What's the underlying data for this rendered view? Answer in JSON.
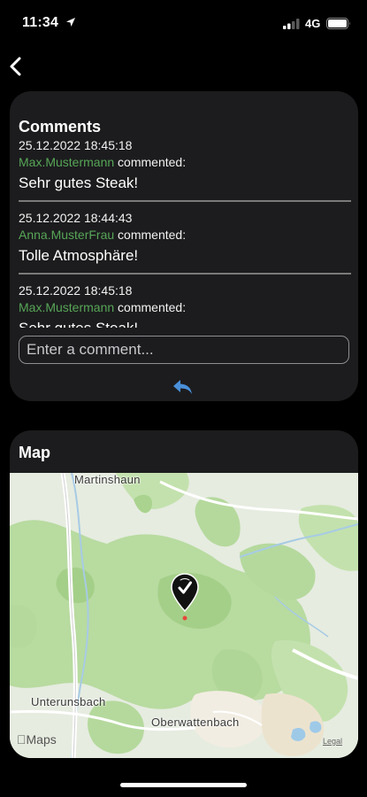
{
  "status_bar": {
    "time": "11:34",
    "network": "4G",
    "icons": [
      "location-arrow-icon",
      "signal-icon",
      "battery-icon"
    ]
  },
  "nav": {
    "back_icon": "chevron-left-icon"
  },
  "comments": {
    "title": "Comments",
    "items": [
      {
        "timestamp": "25.12.2022 18:45:18",
        "author": "Max.Mustermann",
        "action": " commented:",
        "text": "Sehr gutes Steak!"
      },
      {
        "timestamp": "25.12.2022 18:44:43",
        "author": "Anna.MusterFrau",
        "action": " commented:",
        "text": "Tolle Atmosphäre!"
      },
      {
        "timestamp": "25.12.2022 18:45:18",
        "author": "Max.Mustermann",
        "action": " commented:",
        "text": "Sehr gutes Steak!"
      }
    ],
    "input_placeholder": "Enter a comment...",
    "send_icon": "reply-arrow-icon"
  },
  "map": {
    "title": "Map",
    "places": [
      "Martinshaun",
      "Unterunsbach",
      "Oberwattenbach"
    ],
    "attribution": "Maps",
    "legal": "Legal",
    "pin_icon": "map-pin-icon"
  },
  "colors": {
    "background": "#000000",
    "card": "#1c1c1e",
    "author": "#57a657",
    "accent": "#4a90d9"
  }
}
